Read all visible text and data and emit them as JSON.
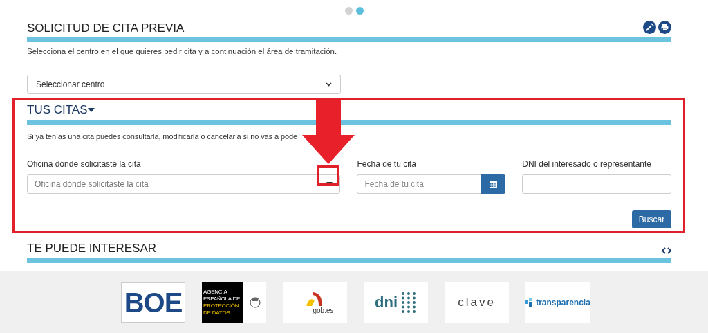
{
  "carousel_dots": [
    {
      "selected": false
    },
    {
      "selected": true
    }
  ],
  "solicitud": {
    "title": "SOLICITUD DE CITA PREVIA",
    "description": "Selecciona el centro en el que quieres pedir cita y a continuación el área de tramitación.",
    "select": {
      "value": "Seleccionar centro"
    }
  },
  "tus_citas": {
    "title": "TUS CITAS",
    "description": "Si ya tenías una cita puedes consultarla, modificarla o cancelarla si no vas a pode",
    "fields": [
      {
        "kind": "select",
        "label": "Oficina dónde solicitaste la cita",
        "placeholder": "Oficina dónde solicitaste la cita"
      },
      {
        "kind": "date",
        "label": "Fecha de tu cita",
        "placeholder": "Fecha de tu cita"
      },
      {
        "kind": "text",
        "label": "DNI del interesado o representante"
      }
    ],
    "button": "Buscar"
  },
  "te_puede_interesar": {
    "title": "TE PUEDE INTERESAR"
  },
  "logos": [
    {
      "kind": "boe",
      "texts": [
        "BOE"
      ]
    },
    {
      "kind": "aepd",
      "texts": [
        "AGENCIA",
        "ESPAÑOLA DE",
        "PROTECCIÓN",
        "DE DATOS"
      ]
    },
    {
      "kind": "gob",
      "texts": [
        "gob.es"
      ]
    },
    {
      "kind": "dni",
      "texts": [
        "dni"
      ]
    },
    {
      "kind": "clave",
      "texts": [
        "clave"
      ]
    },
    {
      "kind": "transparencia",
      "texts": [
        "transparencia"
      ]
    }
  ]
}
